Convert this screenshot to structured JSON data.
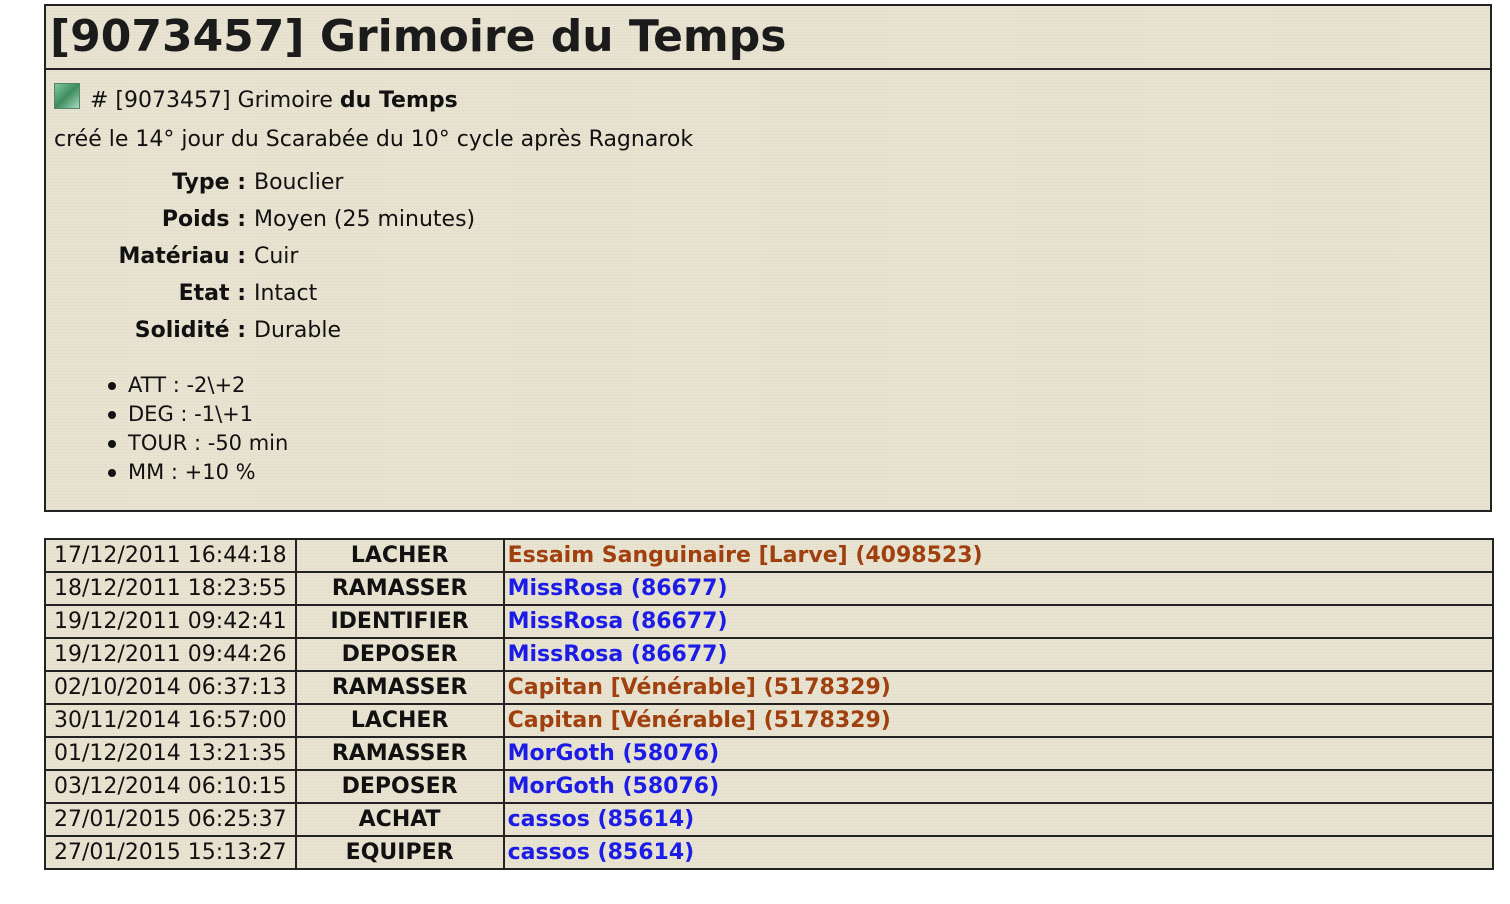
{
  "item": {
    "title": "[9073457] Grimoire du Temps",
    "ref_prefix": "# [9073457] Grimoire ",
    "ref_bold": "du Temps",
    "created": "créé le 14° jour du Scarabée du 10° cycle après Ragnarok",
    "attributes": [
      {
        "label": "Type :",
        "value": "Bouclier"
      },
      {
        "label": "Poids :",
        "value": "Moyen (25 minutes)"
      },
      {
        "label": "Matériau :",
        "value": "Cuir"
      },
      {
        "label": "Etat :",
        "value": "Intact"
      },
      {
        "label": "Solidité :",
        "value": "Durable"
      }
    ],
    "effects": [
      "ATT : -2\\+2",
      "DEG : -1\\+1",
      "TOUR : -50 min",
      "MM : +10 %"
    ]
  },
  "history": [
    {
      "date": "17/12/2011 16:44:18",
      "action": "LACHER",
      "actor": "Essaim Sanguinaire [Larve] (4098523)",
      "actor_type": "monster"
    },
    {
      "date": "18/12/2011 18:23:55",
      "action": "RAMASSER",
      "actor": "MissRosa (86677)",
      "actor_type": "player"
    },
    {
      "date": "19/12/2011 09:42:41",
      "action": "IDENTIFIER",
      "actor": "MissRosa (86677)",
      "actor_type": "player"
    },
    {
      "date": "19/12/2011 09:44:26",
      "action": "DEPOSER",
      "actor": "MissRosa (86677)",
      "actor_type": "player"
    },
    {
      "date": "02/10/2014 06:37:13",
      "action": "RAMASSER",
      "actor": "Capitan [Vénérable] (5178329)",
      "actor_type": "monster"
    },
    {
      "date": "30/11/2014 16:57:00",
      "action": "LACHER",
      "actor": "Capitan [Vénérable] (5178329)",
      "actor_type": "monster"
    },
    {
      "date": "01/12/2014 13:21:35",
      "action": "RAMASSER",
      "actor": "MorGoth (58076)",
      "actor_type": "player"
    },
    {
      "date": "03/12/2014 06:10:15",
      "action": "DEPOSER",
      "actor": "MorGoth (58076)",
      "actor_type": "player"
    },
    {
      "date": "27/01/2015 06:25:37",
      "action": "ACHAT",
      "actor": "cassos (85614)",
      "actor_type": "player"
    },
    {
      "date": "27/01/2015 15:13:27",
      "action": "EQUIPER",
      "actor": "cassos (85614)",
      "actor_type": "player"
    }
  ],
  "colors": {
    "monster_link": "#a0400e",
    "player_link": "#1c1ce8",
    "parchment": "#e9e4d2"
  },
  "icons": {
    "item_icon": "item-thumbnail-icon"
  }
}
